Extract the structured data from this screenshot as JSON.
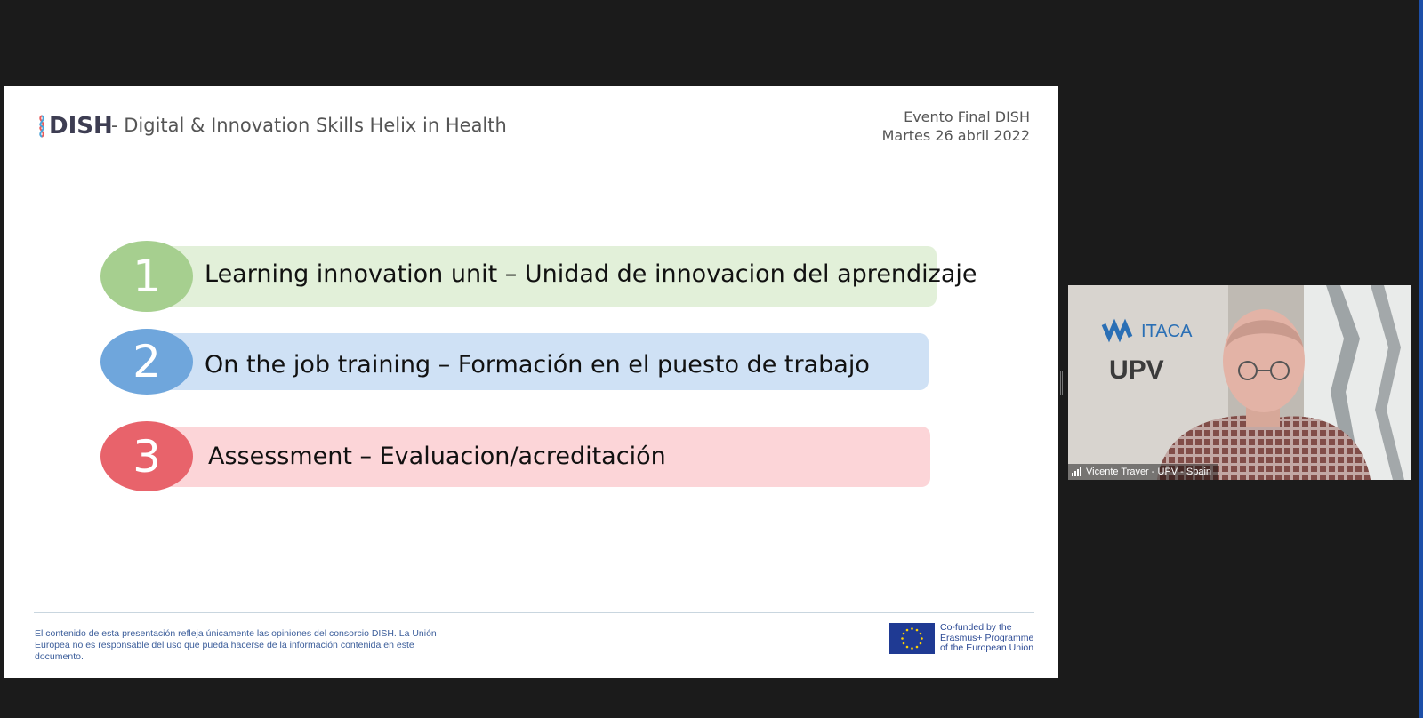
{
  "slide": {
    "logo_text": "DISH",
    "subtitle": "- Digital & Innovation Skills Helix in Health",
    "event_line1": "Evento Final DISH",
    "event_line2": "Martes 26 abril 2022",
    "items": [
      {
        "number": "1",
        "label": "Learning innovation unit – Unidad de innovacion del aprendizaje",
        "circle_color": "#a6cf8f",
        "bar_color": "#e2f0d9"
      },
      {
        "number": "2",
        "label": "On the job training – Formación en el puesto de trabajo",
        "circle_color": "#6fa6dc",
        "bar_color": "#cfe1f5"
      },
      {
        "number": "3",
        "label": "Assessment – Evaluacion/acreditación",
        "circle_color": "#e8636b",
        "bar_color": "#fcd5d8"
      }
    ],
    "disclaimer": "El contenido de esta presentación refleja únicamente las opiniones del consorcio DISH. La Unión Europea no es responsable del uso que pueda hacerse de la información contenida en este documento.",
    "eu_line1": "Co-funded by the",
    "eu_line2": "Erasmus+ Programme",
    "eu_line3": "of the European Union"
  },
  "video": {
    "participant_name": "Vicente Traver - UPV - Spain",
    "backdrop_brand": "ITACA",
    "backdrop_label": "UPV"
  },
  "colors": {
    "background": "#1b1b1b",
    "slide_bg": "#ffffff",
    "accent_edge": "#1d4fa8"
  }
}
